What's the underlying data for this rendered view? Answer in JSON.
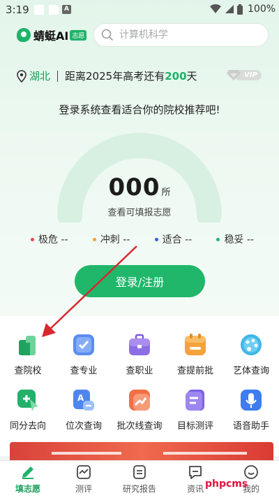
{
  "status_bar": {
    "time": "3:19",
    "battery": "100%"
  },
  "header": {
    "brand": "蜻蜓AI",
    "brand_tag": "志愿",
    "search_placeholder": "计算机科学"
  },
  "info": {
    "province": "湖北",
    "countdown_prefix": "距离2025年高考还有",
    "days": "200",
    "countdown_suffix": "天",
    "vip": "VIP"
  },
  "prompt": "登录系统查看适合你的院校推荐吧!",
  "score": {
    "value": "000",
    "unit": "所",
    "caption": "查看可填报志愿"
  },
  "legend": [
    {
      "label": "极危 --",
      "color": "#e8474d"
    },
    {
      "label": "冲刺 --",
      "color": "#f5a03a"
    },
    {
      "label": "适合 --",
      "color": "#3b5fe0"
    },
    {
      "label": "稳妥 --",
      "color": "#22b573"
    }
  ],
  "login_label": "登录/注册",
  "grid": [
    {
      "label": "查院校",
      "icon": "school-icon"
    },
    {
      "label": "查专业",
      "icon": "major-icon"
    },
    {
      "label": "查职业",
      "icon": "career-icon"
    },
    {
      "label": "查提前批",
      "icon": "early-batch-icon"
    },
    {
      "label": "艺体查询",
      "icon": "art-icon"
    },
    {
      "label": "同分去向",
      "icon": "same-score-icon"
    },
    {
      "label": "位次查询",
      "icon": "rank-icon"
    },
    {
      "label": "批次线查询",
      "icon": "batch-line-icon"
    },
    {
      "label": "目标测评",
      "icon": "target-icon"
    },
    {
      "label": "语音助手",
      "icon": "voice-icon"
    }
  ],
  "tabs": [
    {
      "label": "填志愿",
      "active": true
    },
    {
      "label": "测评",
      "active": false
    },
    {
      "label": "研究报告",
      "active": false
    },
    {
      "label": "资讯",
      "active": false
    },
    {
      "label": "我的",
      "active": false
    }
  ],
  "watermark": "phpcms",
  "colors": {
    "brand": "#20b76a",
    "arrow": "#d6282e"
  }
}
